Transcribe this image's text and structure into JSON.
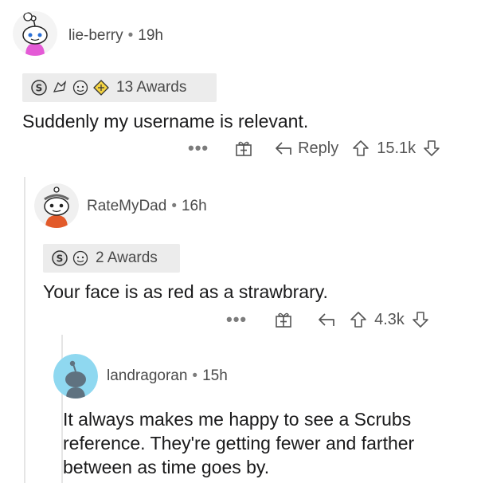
{
  "comments": [
    {
      "username": "lie-berry",
      "time": "19h",
      "awards_label": "13 Awards",
      "body": "Suddenly my username is relevant.",
      "more": "•••",
      "reply_label": "Reply",
      "score": "15.1k"
    },
    {
      "username": "RateMyDad",
      "time": "16h",
      "awards_label": "2 Awards",
      "body": "Your face is as red as a strawbrary.",
      "more": "•••",
      "score": "4.3k"
    },
    {
      "username": "landragoran",
      "time": "15h",
      "body_lines": [
        "It always makes me happy to see a Scrubs",
        "reference. They're getting fewer and farther",
        "between as time goes by."
      ]
    }
  ],
  "separator": "•",
  "icons": {
    "more": "more-options-icon",
    "award": "gift-award-icon",
    "reply": "reply-arrow-icon",
    "upvote": "upvote-arrow-icon",
    "downvote": "downvote-arrow-icon"
  },
  "colors": {
    "text": "#1a1a1b",
    "meta": "#4a4a4a",
    "award_bg": "#ececec",
    "thread_line": "#e5e5e5",
    "avatar_bg_3": "#8fd8f0"
  }
}
